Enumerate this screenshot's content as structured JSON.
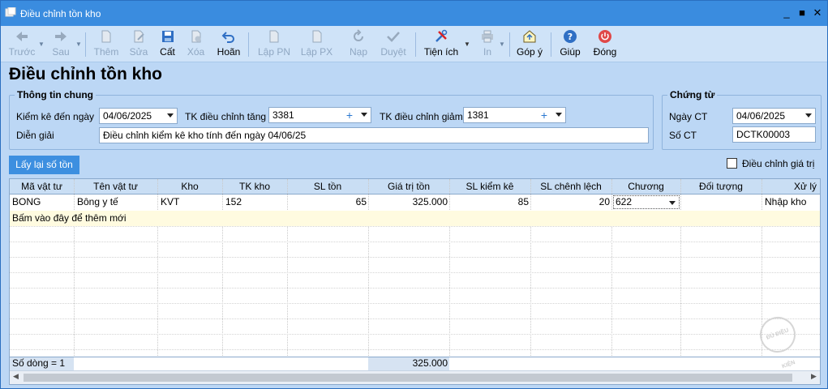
{
  "window": {
    "title": "Điều chỉnh tồn kho",
    "min_glyph": "_",
    "max_glyph": "■",
    "close_glyph": "✕"
  },
  "toolbar": {
    "prev": "Trước",
    "next": "Sau",
    "add": "Thêm",
    "edit": "Sửa",
    "save": "Cất",
    "delete": "Xóa",
    "undo": "Hoãn",
    "create_in": "Lập PN",
    "create_out": "Lập PX",
    "load": "Nạp",
    "approve": "Duyệt",
    "utilities": "Tiện ích",
    "print": "In",
    "feedback": "Góp ý",
    "help": "Giúp",
    "close": "Đóng"
  },
  "page": {
    "heading": "Điều chỉnh tồn kho"
  },
  "general": {
    "legend": "Thông tin chung",
    "inventory_date_label": "Kiểm kê đến ngày",
    "inventory_date": "04/06/2025",
    "increase_account_label": "TK điều chỉnh tăng",
    "increase_account": "3381",
    "decrease_account_label": "TK điều chỉnh giảm",
    "decrease_account": "1381",
    "description_label": "Diễn giải",
    "description": "Điều chỉnh kiểm kê kho tính đến ngày 04/06/25"
  },
  "voucher": {
    "legend": "Chứng từ",
    "date_label": "Ngày CT",
    "date": "04/06/2025",
    "number_label": "Số CT",
    "number": "DCTK00003"
  },
  "actions": {
    "reload_stock": "Lấy lại số tồn",
    "adjust_value_label": "Điều chỉnh giá trị",
    "adjust_value_checked": false
  },
  "grid": {
    "columns": [
      "Mã vật tư",
      "Tên vật tư",
      "Kho",
      "TK kho",
      "SL tồn",
      "Giá trị tồn",
      "SL kiểm kê",
      "SL chênh lệch",
      "Chương",
      "Đối tượng",
      "Xử lý"
    ],
    "rows": [
      {
        "code": "BONG",
        "name": "Bông y tế",
        "warehouse": "KVT",
        "account": "152",
        "qty": "65",
        "value": "325.000",
        "counted": "85",
        "diff": "20",
        "chapter": "622",
        "object": "",
        "handling": "Nhập kho"
      }
    ],
    "new_row_hint": "Bấm vào đây để thêm mới",
    "footer_count": "Số dòng = 1",
    "footer_total": "325.000"
  },
  "stamp_text": "ĐỦ ĐIỀU KIỆN"
}
